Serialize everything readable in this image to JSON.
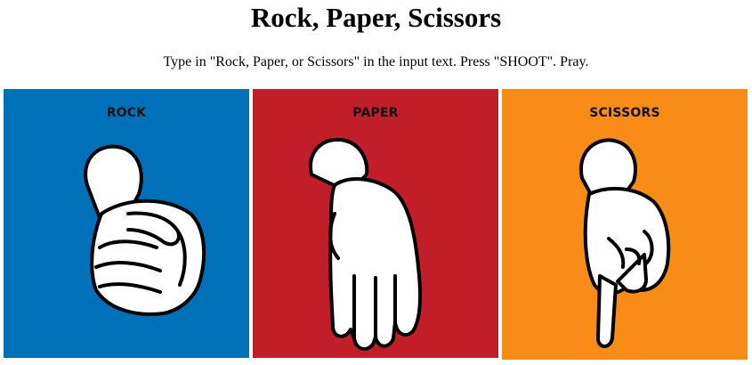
{
  "page": {
    "title": "Rock, Paper, Scissors",
    "instructions": "Type in \"Rock, Paper, or Scissors\" in the input text. Press \"SHOOT\". Pray."
  },
  "cards": [
    {
      "label": "ROCK",
      "color": "#0071b8",
      "icon": "rock-hand-icon"
    },
    {
      "label": "PAPER",
      "color": "#c21e29",
      "icon": "paper-hand-icon"
    },
    {
      "label": "SCISSORS",
      "color": "#f98c16",
      "icon": "scissors-hand-icon"
    }
  ]
}
